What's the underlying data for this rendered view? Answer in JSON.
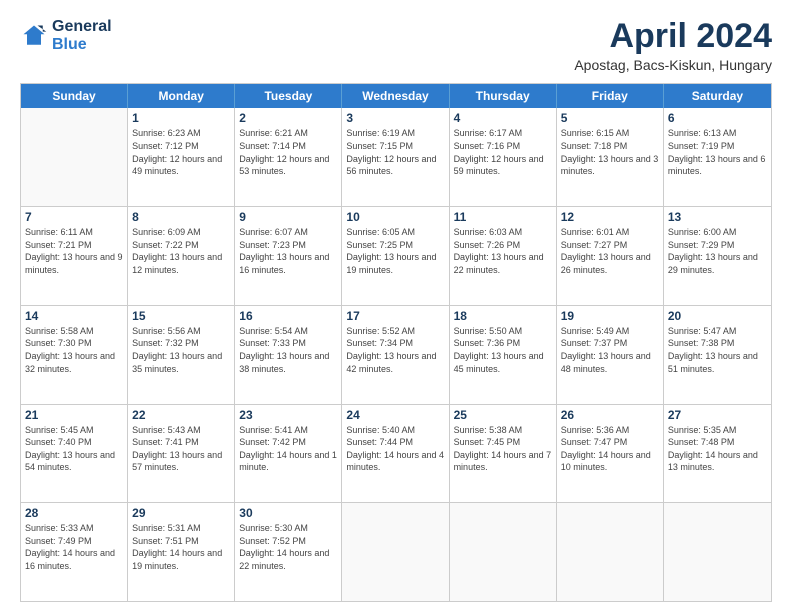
{
  "logo": {
    "line1": "General",
    "line2": "Blue"
  },
  "title": "April 2024",
  "subtitle": "Apostag, Bacs-Kiskun, Hungary",
  "weekdays": [
    "Sunday",
    "Monday",
    "Tuesday",
    "Wednesday",
    "Thursday",
    "Friday",
    "Saturday"
  ],
  "weeks": [
    [
      {
        "day": "",
        "sunrise": "",
        "sunset": "",
        "daylight": ""
      },
      {
        "day": "1",
        "sunrise": "Sunrise: 6:23 AM",
        "sunset": "Sunset: 7:12 PM",
        "daylight": "Daylight: 12 hours and 49 minutes."
      },
      {
        "day": "2",
        "sunrise": "Sunrise: 6:21 AM",
        "sunset": "Sunset: 7:14 PM",
        "daylight": "Daylight: 12 hours and 53 minutes."
      },
      {
        "day": "3",
        "sunrise": "Sunrise: 6:19 AM",
        "sunset": "Sunset: 7:15 PM",
        "daylight": "Daylight: 12 hours and 56 minutes."
      },
      {
        "day": "4",
        "sunrise": "Sunrise: 6:17 AM",
        "sunset": "Sunset: 7:16 PM",
        "daylight": "Daylight: 12 hours and 59 minutes."
      },
      {
        "day": "5",
        "sunrise": "Sunrise: 6:15 AM",
        "sunset": "Sunset: 7:18 PM",
        "daylight": "Daylight: 13 hours and 3 minutes."
      },
      {
        "day": "6",
        "sunrise": "Sunrise: 6:13 AM",
        "sunset": "Sunset: 7:19 PM",
        "daylight": "Daylight: 13 hours and 6 minutes."
      }
    ],
    [
      {
        "day": "7",
        "sunrise": "Sunrise: 6:11 AM",
        "sunset": "Sunset: 7:21 PM",
        "daylight": "Daylight: 13 hours and 9 minutes."
      },
      {
        "day": "8",
        "sunrise": "Sunrise: 6:09 AM",
        "sunset": "Sunset: 7:22 PM",
        "daylight": "Daylight: 13 hours and 12 minutes."
      },
      {
        "day": "9",
        "sunrise": "Sunrise: 6:07 AM",
        "sunset": "Sunset: 7:23 PM",
        "daylight": "Daylight: 13 hours and 16 minutes."
      },
      {
        "day": "10",
        "sunrise": "Sunrise: 6:05 AM",
        "sunset": "Sunset: 7:25 PM",
        "daylight": "Daylight: 13 hours and 19 minutes."
      },
      {
        "day": "11",
        "sunrise": "Sunrise: 6:03 AM",
        "sunset": "Sunset: 7:26 PM",
        "daylight": "Daylight: 13 hours and 22 minutes."
      },
      {
        "day": "12",
        "sunrise": "Sunrise: 6:01 AM",
        "sunset": "Sunset: 7:27 PM",
        "daylight": "Daylight: 13 hours and 26 minutes."
      },
      {
        "day": "13",
        "sunrise": "Sunrise: 6:00 AM",
        "sunset": "Sunset: 7:29 PM",
        "daylight": "Daylight: 13 hours and 29 minutes."
      }
    ],
    [
      {
        "day": "14",
        "sunrise": "Sunrise: 5:58 AM",
        "sunset": "Sunset: 7:30 PM",
        "daylight": "Daylight: 13 hours and 32 minutes."
      },
      {
        "day": "15",
        "sunrise": "Sunrise: 5:56 AM",
        "sunset": "Sunset: 7:32 PM",
        "daylight": "Daylight: 13 hours and 35 minutes."
      },
      {
        "day": "16",
        "sunrise": "Sunrise: 5:54 AM",
        "sunset": "Sunset: 7:33 PM",
        "daylight": "Daylight: 13 hours and 38 minutes."
      },
      {
        "day": "17",
        "sunrise": "Sunrise: 5:52 AM",
        "sunset": "Sunset: 7:34 PM",
        "daylight": "Daylight: 13 hours and 42 minutes."
      },
      {
        "day": "18",
        "sunrise": "Sunrise: 5:50 AM",
        "sunset": "Sunset: 7:36 PM",
        "daylight": "Daylight: 13 hours and 45 minutes."
      },
      {
        "day": "19",
        "sunrise": "Sunrise: 5:49 AM",
        "sunset": "Sunset: 7:37 PM",
        "daylight": "Daylight: 13 hours and 48 minutes."
      },
      {
        "day": "20",
        "sunrise": "Sunrise: 5:47 AM",
        "sunset": "Sunset: 7:38 PM",
        "daylight": "Daylight: 13 hours and 51 minutes."
      }
    ],
    [
      {
        "day": "21",
        "sunrise": "Sunrise: 5:45 AM",
        "sunset": "Sunset: 7:40 PM",
        "daylight": "Daylight: 13 hours and 54 minutes."
      },
      {
        "day": "22",
        "sunrise": "Sunrise: 5:43 AM",
        "sunset": "Sunset: 7:41 PM",
        "daylight": "Daylight: 13 hours and 57 minutes."
      },
      {
        "day": "23",
        "sunrise": "Sunrise: 5:41 AM",
        "sunset": "Sunset: 7:42 PM",
        "daylight": "Daylight: 14 hours and 1 minute."
      },
      {
        "day": "24",
        "sunrise": "Sunrise: 5:40 AM",
        "sunset": "Sunset: 7:44 PM",
        "daylight": "Daylight: 14 hours and 4 minutes."
      },
      {
        "day": "25",
        "sunrise": "Sunrise: 5:38 AM",
        "sunset": "Sunset: 7:45 PM",
        "daylight": "Daylight: 14 hours and 7 minutes."
      },
      {
        "day": "26",
        "sunrise": "Sunrise: 5:36 AM",
        "sunset": "Sunset: 7:47 PM",
        "daylight": "Daylight: 14 hours and 10 minutes."
      },
      {
        "day": "27",
        "sunrise": "Sunrise: 5:35 AM",
        "sunset": "Sunset: 7:48 PM",
        "daylight": "Daylight: 14 hours and 13 minutes."
      }
    ],
    [
      {
        "day": "28",
        "sunrise": "Sunrise: 5:33 AM",
        "sunset": "Sunset: 7:49 PM",
        "daylight": "Daylight: 14 hours and 16 minutes."
      },
      {
        "day": "29",
        "sunrise": "Sunrise: 5:31 AM",
        "sunset": "Sunset: 7:51 PM",
        "daylight": "Daylight: 14 hours and 19 minutes."
      },
      {
        "day": "30",
        "sunrise": "Sunrise: 5:30 AM",
        "sunset": "Sunset: 7:52 PM",
        "daylight": "Daylight: 14 hours and 22 minutes."
      },
      {
        "day": "",
        "sunrise": "",
        "sunset": "",
        "daylight": ""
      },
      {
        "day": "",
        "sunrise": "",
        "sunset": "",
        "daylight": ""
      },
      {
        "day": "",
        "sunrise": "",
        "sunset": "",
        "daylight": ""
      },
      {
        "day": "",
        "sunrise": "",
        "sunset": "",
        "daylight": ""
      }
    ]
  ]
}
